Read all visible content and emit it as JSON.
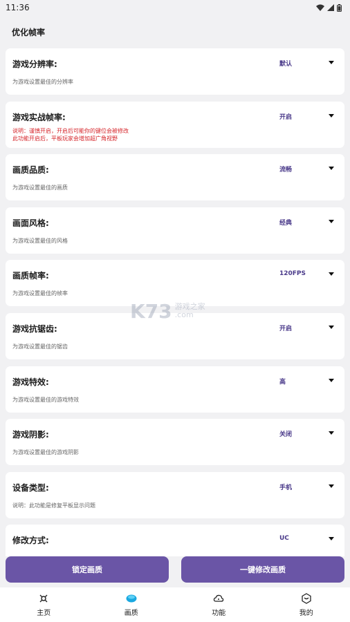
{
  "status": {
    "time": "11:36"
  },
  "page": {
    "title": "优化帧率"
  },
  "settings": [
    {
      "title": "游戏分辨率:",
      "desc": "为游戏设置最佳的分辨率",
      "value": "默认"
    },
    {
      "title": "游戏实战帧率:",
      "desc_line1": "说明：谨慎开启，开启后可能你的键位会被修改",
      "desc_line2": "此功能开启后，平板玩家会增加超广角视野",
      "value": "开启"
    },
    {
      "title": "画质品质:",
      "desc": "为游戏设置最佳的画质",
      "value": "流畅"
    },
    {
      "title": "画面风格:",
      "desc": "为游戏设置最佳的风格",
      "value": "经典"
    },
    {
      "title": "画质帧率:",
      "desc": "为游戏设置最佳的帧率",
      "value": "120FPS"
    },
    {
      "title": "游戏抗锯齿:",
      "desc": "为游戏设置最佳的锯齿",
      "value": "开启"
    },
    {
      "title": "游戏特效:",
      "desc": "为游戏设置最佳的游戏特效",
      "value": "高"
    },
    {
      "title": "游戏阴影:",
      "desc": "为游戏设置最佳的游戏阴影",
      "value": "关闭"
    },
    {
      "title": "设备类型:",
      "desc": "说明：此功能是修复平板显示问题",
      "value": "手机"
    },
    {
      "title": "修改方式:",
      "desc": "",
      "value": "UC"
    }
  ],
  "buttons": {
    "lock": "锁定画质",
    "apply": "一键修改画质"
  },
  "tabs": [
    {
      "label": "主页",
      "icon": "home-icon"
    },
    {
      "label": "画质",
      "icon": "quality-icon"
    },
    {
      "label": "功能",
      "icon": "function-icon"
    },
    {
      "label": "我的",
      "icon": "profile-icon"
    }
  ],
  "watermark": {
    "big": "K73",
    "line1": "游戏之家",
    "line2": ".com"
  },
  "colors": {
    "accent": "#6a55a6",
    "warning": "#d6262b",
    "value": "#4a3a8a"
  }
}
